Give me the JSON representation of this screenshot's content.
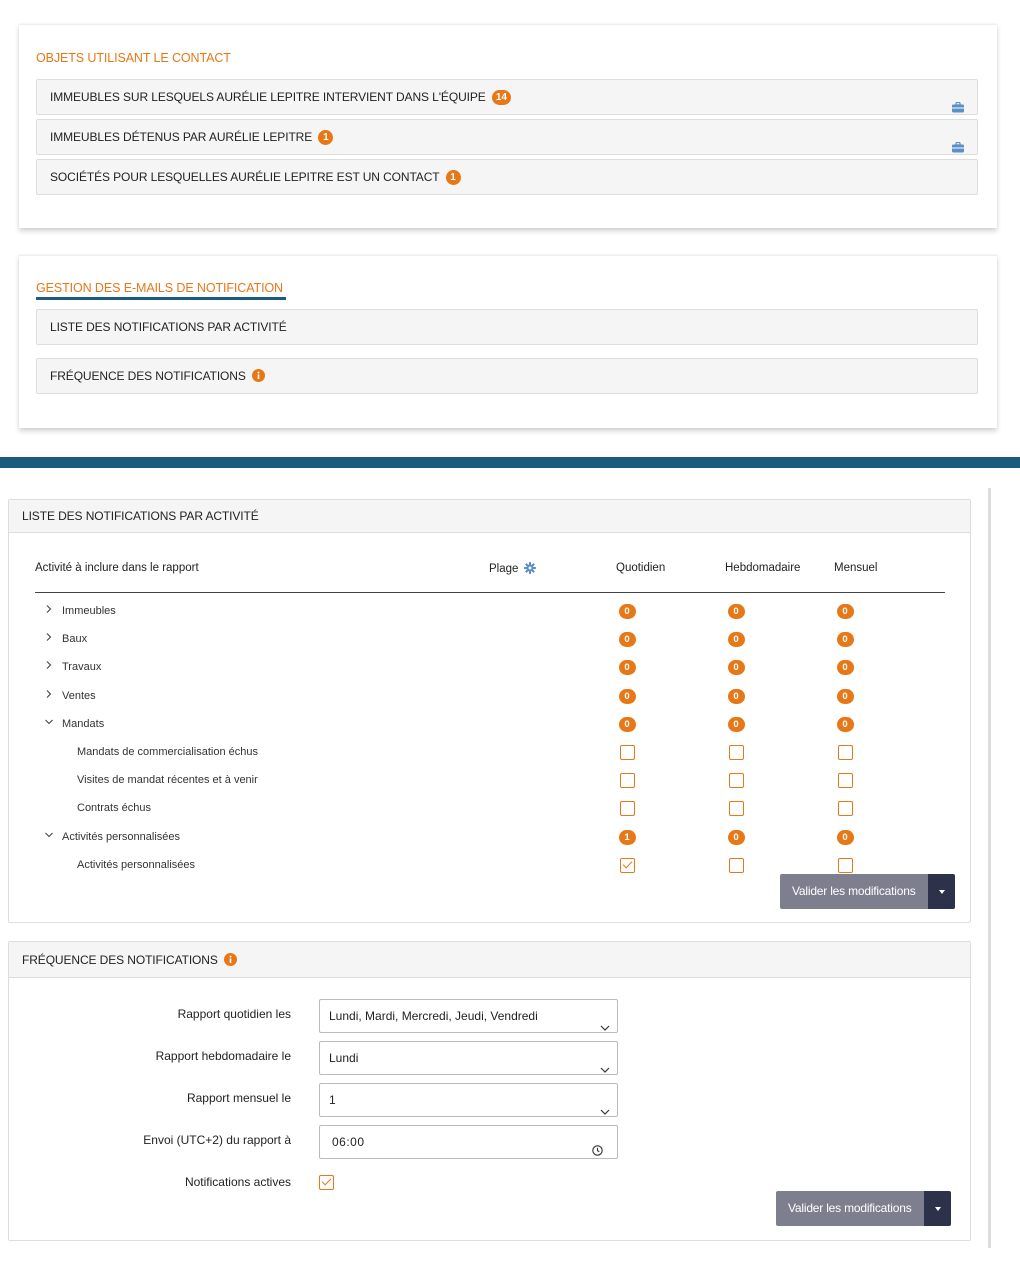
{
  "objets": {
    "title": "OBJETS UTILISANT LE CONTACT",
    "rows": [
      {
        "label": "IMMEUBLES SUR LESQUELS AURÉLIE LEPITRE INTERVIENT DANS L'ÉQUIPE",
        "count": "14",
        "icon": "briefcase-icon"
      },
      {
        "label": "IMMEUBLES DÉTENUS PAR AURÉLIE LEPITRE",
        "count": "1",
        "icon": "briefcase-icon"
      },
      {
        "label": "SOCIÉTÉS POUR LESQUELLES AURÉLIE LEPITRE EST UN CONTACT",
        "count": "1"
      }
    ]
  },
  "gestion": {
    "title": "GESTION DES E-MAILS DE NOTIFICATION",
    "rows": [
      {
        "label": "LISTE DES NOTIFICATIONS PAR ACTIVITÉ"
      },
      {
        "label": "FRÉQUENCE DES NOTIFICATIONS",
        "icon": "info-icon"
      }
    ]
  },
  "liste": {
    "title": "LISTE DES NOTIFICATIONS PAR ACTIVITÉ",
    "headers": {
      "activite": "Activité à inclure dans le rapport",
      "plage": "Plage",
      "quotidien": "Quotidien",
      "hebdomadaire": "Hebdomadaire",
      "mensuel": "Mensuel"
    },
    "rows": [
      {
        "label": "Immeubles",
        "level": 0,
        "expanded": false,
        "quotidien": "0",
        "hebdomadaire": "0",
        "mensuel": "0"
      },
      {
        "label": "Baux",
        "level": 0,
        "expanded": false,
        "quotidien": "0",
        "hebdomadaire": "0",
        "mensuel": "0"
      },
      {
        "label": "Travaux",
        "level": 0,
        "expanded": false,
        "quotidien": "0",
        "hebdomadaire": "0",
        "mensuel": "0"
      },
      {
        "label": "Ventes",
        "level": 0,
        "expanded": false,
        "quotidien": "0",
        "hebdomadaire": "0",
        "mensuel": "0"
      },
      {
        "label": "Mandats",
        "level": 0,
        "expanded": true,
        "quotidien": "0",
        "hebdomadaire": "0",
        "mensuel": "0"
      },
      {
        "label": "Mandats de commercialisation échus",
        "level": 1,
        "quotidien": false,
        "hebdomadaire": false,
        "mensuel": false
      },
      {
        "label": "Visites de mandat récentes et à venir",
        "level": 1,
        "quotidien": false,
        "hebdomadaire": false,
        "mensuel": false
      },
      {
        "label": "Contrats échus",
        "level": 1,
        "quotidien": false,
        "hebdomadaire": false,
        "mensuel": false
      },
      {
        "label": "Activités personnalisées",
        "level": 0,
        "expanded": true,
        "quotidien": "1",
        "hebdomadaire": "0",
        "mensuel": "0"
      },
      {
        "label": "Activités personnalisées",
        "level": 1,
        "quotidien": true,
        "hebdomadaire": false,
        "mensuel": false
      }
    ],
    "submit_label": "Valider les modifications"
  },
  "frequence": {
    "title": "FRÉQUENCE DES NOTIFICATIONS",
    "fields": {
      "quotidien": {
        "label": "Rapport quotidien les",
        "value": "Lundi, Mardi, Mercredi, Jeudi, Vendredi"
      },
      "hebdomadaire": {
        "label": "Rapport hebdomadaire le",
        "value": "Lundi"
      },
      "mensuel": {
        "label": "Rapport mensuel le",
        "value": "1"
      },
      "envoi": {
        "label": "Envoi (UTC+2) du rapport à",
        "value": "06:00"
      },
      "actives": {
        "label": "Notifications actives",
        "checked": true
      }
    },
    "submit_label": "Valider les modifications"
  },
  "colors": {
    "accent": "#e77817",
    "navy": "#1b5b7e",
    "button": "#7d7f8e",
    "button_dark": "#2c3249",
    "icon_blue": "#5b8fc7"
  }
}
